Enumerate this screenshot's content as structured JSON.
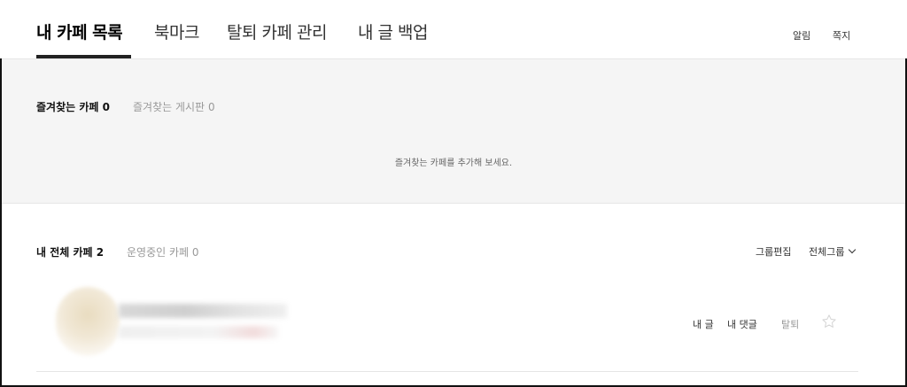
{
  "nav": {
    "tabs": [
      {
        "label": "내 카페 목록",
        "active": true
      },
      {
        "label": "북마크",
        "active": false
      },
      {
        "label": "탈퇴 카페 관리",
        "active": false
      },
      {
        "label": "내 글 백업",
        "active": false
      }
    ],
    "notifications_label": "알림",
    "messages_label": "쪽지"
  },
  "favorites": {
    "tab_cafe_label": "즐겨찾는 카페",
    "tab_cafe_count": "0",
    "tab_board_label": "즐겨찾는 게시판",
    "tab_board_count": "0",
    "empty_message": "즐겨찾는 카페를 추가해 보세요."
  },
  "my_cafes": {
    "tab_all_label": "내 전체 카페",
    "tab_all_count": "2",
    "tab_managed_label": "운영중인 카페",
    "tab_managed_count": "0",
    "group_edit_label": "그룹편집",
    "group_select_label": "전체그룹",
    "row": {
      "my_posts_label": "내 글",
      "my_comments_label": "내 댓글",
      "leave_label": "탈퇴"
    }
  },
  "colors": {
    "active_text": "#000000",
    "inactive_text": "#999999",
    "fav_background": "#f5f5f5",
    "underline": "#222222"
  }
}
